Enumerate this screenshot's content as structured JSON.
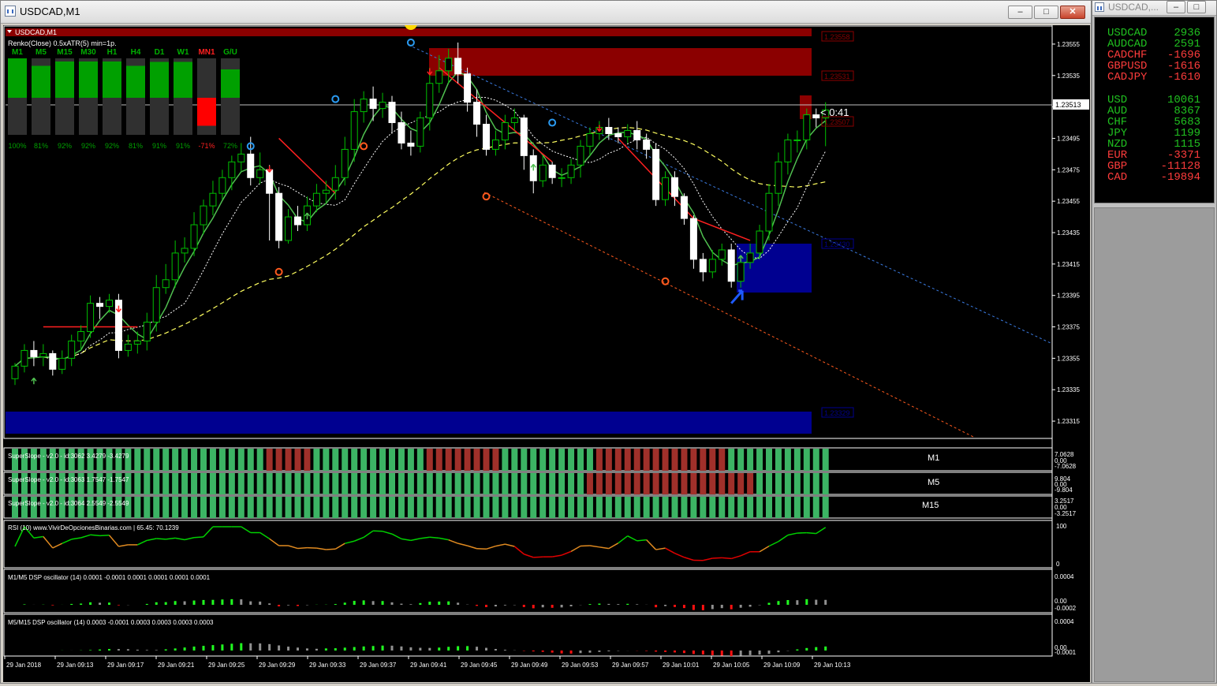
{
  "main_window": {
    "title": "USDCAD,M1",
    "buttons": {
      "minimize": "–",
      "maximize": "□",
      "close": "✕"
    }
  },
  "side_window": {
    "title": "USDCAD,...",
    "buttons": {
      "minimize": "–",
      "maximize": "□",
      "close": "✕"
    }
  },
  "colors": {
    "bull": "#00b000",
    "bear": "#e00000",
    "green_text": "#00c000",
    "red_text": "#ff3030"
  },
  "chart_header": {
    "symbol_label": "USDCAD,M1",
    "renko_label": "Renko(Close) 0.5xATR(5) min=1p."
  },
  "timeframe_meter": [
    {
      "tf": "M1",
      "pct": "100%",
      "value": 100,
      "color": "green"
    },
    {
      "tf": "M5",
      "pct": "81%",
      "value": 81,
      "color": "green"
    },
    {
      "tf": "M15",
      "pct": "92%",
      "value": 92,
      "color": "green"
    },
    {
      "tf": "M30",
      "pct": "92%",
      "value": 92,
      "color": "green"
    },
    {
      "tf": "H1",
      "pct": "92%",
      "value": 92,
      "color": "green"
    },
    {
      "tf": "H4",
      "pct": "81%",
      "value": 81,
      "color": "green"
    },
    {
      "tf": "D1",
      "pct": "91%",
      "value": 91,
      "color": "green"
    },
    {
      "tf": "W1",
      "pct": "91%",
      "value": 91,
      "color": "green"
    },
    {
      "tf": "MN1",
      "pct": "-71%",
      "value": -71,
      "color": "red"
    },
    {
      "tf": "G/U",
      "pct": "72%",
      "value": 72,
      "color": "green"
    }
  ],
  "price_labels": {
    "zone_top": "1.23558",
    "zone_upper": "1.23531",
    "current_price": "1.23513",
    "current_tag": "1.23507",
    "timer": "< 0:41",
    "zone_lower_mid": "1.23430",
    "zone_bottom": "1.23329"
  },
  "indicators": {
    "ss1": {
      "label": "SuperSlope - v2.0 - id:3062 3.4279 -3.4279",
      "tf": "M1",
      "scale": [
        "7.0628",
        "0.00",
        "-7.0628"
      ]
    },
    "ss2": {
      "label": "SuperSlope - v2.0 - id:3063 1.7547 -1.7547",
      "tf": "M5",
      "scale": [
        "9.804",
        "0.00",
        "-9.804"
      ]
    },
    "ss3": {
      "label": "SuperSlope - v2.0 - id:3064 2.5549 -2.5549",
      "tf": "M15",
      "scale": [
        "3.2517",
        "0.00",
        "-3.2517"
      ]
    },
    "rsi": {
      "label": "RSI (10) www.VivirDeOpcionesBinarias.com | 65.45: 70.1239",
      "scale": [
        "100",
        "0"
      ]
    },
    "dsp1": {
      "label": "M1/M5 DSP oscillator (14) 0.0001 -0.0001 0.0001 0.0001 0.0001 0.0001",
      "scale": [
        "0.0004",
        "0.00",
        "-0.0002"
      ]
    },
    "dsp2": {
      "label": "M5/M15 DSP oscillator (14) 0.0003 -0.0001 0.0003 0.0003 0.0003 0.0003",
      "scale": [
        "0.0004",
        "0.00",
        "-0.0001"
      ]
    }
  },
  "currency_strength": {
    "pairs": [
      {
        "name": "USDCAD",
        "value": "2936",
        "color": "green"
      },
      {
        "name": "AUDCAD",
        "value": "2591",
        "color": "green"
      },
      {
        "name": "CADCHF",
        "value": "-1696",
        "color": "red"
      },
      {
        "name": "GBPUSD",
        "value": "-1616",
        "color": "red"
      },
      {
        "name": "CADJPY",
        "value": "-1610",
        "color": "red"
      }
    ],
    "currencies": [
      {
        "name": "USD",
        "value": "10061",
        "color": "green"
      },
      {
        "name": "AUD",
        "value": "8367",
        "color": "green"
      },
      {
        "name": "CHF",
        "value": "5683",
        "color": "green"
      },
      {
        "name": "JPY",
        "value": "1199",
        "color": "green"
      },
      {
        "name": "NZD",
        "value": "1115",
        "color": "green"
      },
      {
        "name": "EUR",
        "value": "-3371",
        "color": "red"
      },
      {
        "name": "GBP",
        "value": "-11128",
        "color": "red"
      },
      {
        "name": "CAD",
        "value": "-19894",
        "color": "red"
      }
    ]
  },
  "chart_data": {
    "type": "candlestick",
    "title": "USDCAD,M1",
    "y_ticks": [
      "1.23555",
      "1.23535",
      "1.23515",
      "1.23495",
      "1.23475",
      "1.23455",
      "1.23435",
      "1.23415",
      "1.23395",
      "1.23375",
      "1.23355",
      "1.23335",
      "1.23315"
    ],
    "ylim": [
      1.23305,
      1.23565
    ],
    "x_ticks": [
      "29 Jan 2018",
      "29 Jan 09:13",
      "29 Jan 09:17",
      "29 Jan 09:21",
      "29 Jan 09:25",
      "29 Jan 09:29",
      "29 Jan 09:33",
      "29 Jan 09:37",
      "29 Jan 09:41",
      "29 Jan 09:45",
      "29 Jan 09:49",
      "29 Jan 09:53",
      "29 Jan 09:57",
      "29 Jan 10:01",
      "29 Jan 10:05",
      "29 Jan 10:09",
      "29 Jan 10:13"
    ],
    "candles": [
      [
        1.23342,
        1.2335,
        1.23338,
        1.23352
      ],
      [
        1.2335,
        1.2336,
        1.23346,
        1.23364
      ],
      [
        1.2336,
        1.23356,
        1.2335,
        1.23366
      ],
      [
        1.23356,
        1.23358,
        1.2335,
        1.23364
      ],
      [
        1.23358,
        1.23348,
        1.23344,
        1.2336
      ],
      [
        1.23348,
        1.23355,
        1.23345,
        1.2336
      ],
      [
        1.23355,
        1.23366,
        1.2335,
        1.2337
      ],
      [
        1.23366,
        1.23372,
        1.2336,
        1.23376
      ],
      [
        1.23372,
        1.2339,
        1.23368,
        1.23395
      ],
      [
        1.2339,
        1.23388,
        1.2338,
        1.23394
      ],
      [
        1.23388,
        1.23392,
        1.23384,
        1.23396
      ],
      [
        1.23392,
        1.2336,
        1.23355,
        1.23396
      ],
      [
        1.2336,
        1.23364,
        1.23356,
        1.2337
      ],
      [
        1.23364,
        1.23366,
        1.23358,
        1.23372
      ],
      [
        1.23366,
        1.23378,
        1.2336,
        1.23384
      ],
      [
        1.23378,
        1.234,
        1.23372,
        1.23408
      ],
      [
        1.234,
        1.23405,
        1.23396,
        1.23415
      ],
      [
        1.23405,
        1.23422,
        1.234,
        1.2343
      ],
      [
        1.23422,
        1.23425,
        1.23416,
        1.23432
      ],
      [
        1.23425,
        1.2344,
        1.2342,
        1.23448
      ],
      [
        1.2344,
        1.23452,
        1.23434,
        1.23456
      ],
      [
        1.23452,
        1.2346,
        1.23446,
        1.23468
      ],
      [
        1.2346,
        1.2347,
        1.23456,
        1.23475
      ],
      [
        1.2347,
        1.2348,
        1.23462,
        1.23484
      ],
      [
        1.2348,
        1.23485,
        1.23474,
        1.23492
      ],
      [
        1.23485,
        1.2347,
        1.23465,
        1.23496
      ],
      [
        1.2347,
        1.23475,
        1.23466,
        1.23486
      ],
      [
        1.23475,
        1.2346,
        1.2343,
        1.23478
      ],
      [
        1.2346,
        1.2343,
        1.23425,
        1.23464
      ],
      [
        1.2343,
        1.23445,
        1.23428,
        1.2345
      ],
      [
        1.23445,
        1.2344,
        1.23436,
        1.23452
      ],
      [
        1.2344,
        1.23452,
        1.23436,
        1.23458
      ],
      [
        1.23452,
        1.2346,
        1.23448,
        1.23466
      ],
      [
        1.2346,
        1.23462,
        1.23454,
        1.23468
      ],
      [
        1.23462,
        1.2347,
        1.23456,
        1.23478
      ],
      [
        1.2347,
        1.23488,
        1.23465,
        1.23496
      ],
      [
        1.23488,
        1.23512,
        1.2348,
        1.2352
      ],
      [
        1.23512,
        1.2352,
        1.23505,
        1.23525
      ],
      [
        1.2352,
        1.23514,
        1.23506,
        1.23528
      ],
      [
        1.23514,
        1.23518,
        1.23508,
        1.23524
      ],
      [
        1.23518,
        1.23505,
        1.23498,
        1.23522
      ],
      [
        1.23505,
        1.23492,
        1.23488,
        1.23512
      ],
      [
        1.23492,
        1.2349,
        1.23484,
        1.235
      ],
      [
        1.2349,
        1.23508,
        1.23486,
        1.23512
      ],
      [
        1.23508,
        1.2353,
        1.235,
        1.2354
      ],
      [
        1.2353,
        1.23538,
        1.23524,
        1.23548
      ],
      [
        1.23538,
        1.23546,
        1.2353,
        1.23552
      ],
      [
        1.23546,
        1.23536,
        1.2353,
        1.23556
      ],
      [
        1.23536,
        1.23518,
        1.23512,
        1.2354
      ],
      [
        1.23518,
        1.23504,
        1.23496,
        1.23526
      ],
      [
        1.23504,
        1.23488,
        1.23484,
        1.2351
      ],
      [
        1.23488,
        1.23494,
        1.23484,
        1.235
      ],
      [
        1.23494,
        1.23505,
        1.23488,
        1.2351
      ],
      [
        1.23505,
        1.23508,
        1.235,
        1.23514
      ],
      [
        1.23508,
        1.23484,
        1.23475,
        1.2351
      ],
      [
        1.23484,
        1.23468,
        1.2346,
        1.23488
      ],
      [
        1.23468,
        1.23478,
        1.23464,
        1.23484
      ],
      [
        1.23478,
        1.2347,
        1.23466,
        1.2348
      ],
      [
        1.2347,
        1.2347,
        1.23464,
        1.23476
      ],
      [
        1.2347,
        1.23478,
        1.23466,
        1.23482
      ],
      [
        1.23478,
        1.2349,
        1.2347,
        1.23494
      ],
      [
        1.2349,
        1.23498,
        1.23484,
        1.23502
      ],
      [
        1.23498,
        1.23502,
        1.23494,
        1.23506
      ],
      [
        1.23502,
        1.23498,
        1.23494,
        1.23508
      ],
      [
        1.23498,
        1.23496,
        1.23492,
        1.23502
      ],
      [
        1.23496,
        1.235,
        1.23492,
        1.23504
      ],
      [
        1.235,
        1.23494,
        1.23488,
        1.23506
      ],
      [
        1.23494,
        1.23488,
        1.23482,
        1.23498
      ],
      [
        1.23488,
        1.23456,
        1.23452,
        1.23492
      ],
      [
        1.23456,
        1.2347,
        1.23452,
        1.23474
      ],
      [
        1.2347,
        1.23458,
        1.23452,
        1.23474
      ],
      [
        1.23458,
        1.23444,
        1.2344,
        1.2346
      ],
      [
        1.23444,
        1.23418,
        1.23412,
        1.23446
      ],
      [
        1.23418,
        1.2341,
        1.23404,
        1.23422
      ],
      [
        1.2341,
        1.23418,
        1.23406,
        1.23424
      ],
      [
        1.23418,
        1.23424,
        1.23414,
        1.23428
      ],
      [
        1.23424,
        1.23404,
        1.234,
        1.23428
      ],
      [
        1.23404,
        1.23416,
        1.234,
        1.2342
      ],
      [
        1.23416,
        1.23422,
        1.23412,
        1.23428
      ],
      [
        1.23422,
        1.23436,
        1.23418,
        1.2344
      ],
      [
        1.23436,
        1.2346,
        1.2343,
        1.23466
      ],
      [
        1.2346,
        1.2348,
        1.23452,
        1.23486
      ],
      [
        1.2348,
        1.23494,
        1.23472,
        1.23498
      ],
      [
        1.23494,
        1.23494,
        1.23486,
        1.235
      ],
      [
        1.23494,
        1.2351,
        1.23488,
        1.23514
      ],
      [
        1.2351,
        1.23508,
        1.23502,
        1.23514
      ],
      [
        1.23508,
        1.23513,
        1.2349,
        1.23518
      ]
    ]
  }
}
